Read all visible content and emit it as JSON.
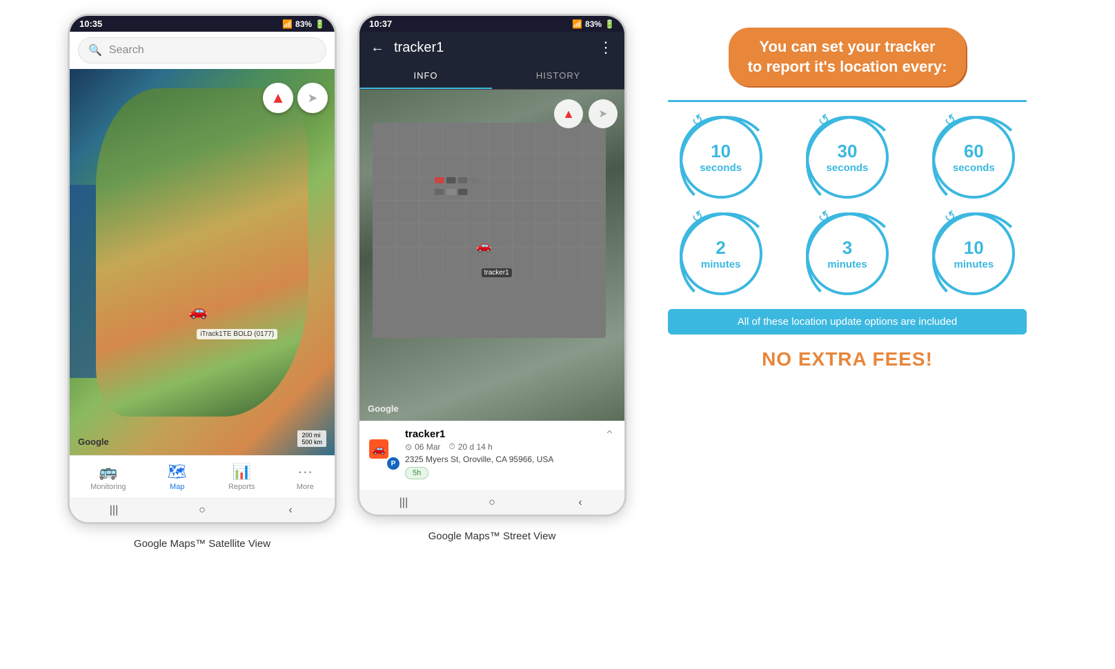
{
  "phone1": {
    "status_time": "10:35",
    "status_signal": "📶",
    "status_battery": "83%",
    "search_placeholder": "Search",
    "compass_icon": "🧭",
    "nav_icon": "➤",
    "car_marker": "🚗",
    "tracker_label": "iTrack1TE BOLD (0177)",
    "scale_text": "200 mi\n500 km",
    "google_logo": "Google",
    "nav_items": [
      {
        "label": "Monitoring",
        "icon": "🚌",
        "active": false
      },
      {
        "label": "Map",
        "icon": "🗺",
        "active": true
      },
      {
        "label": "Reports",
        "icon": "📊",
        "active": false
      },
      {
        "label": "More",
        "icon": "···",
        "active": false
      }
    ],
    "caption": "Google Maps™ Satellite View"
  },
  "phone2": {
    "status_time": "10:37",
    "status_signal": "📶",
    "status_battery": "83%",
    "back_arrow": "←",
    "title": "tracker1",
    "more_icon": "⋮",
    "tabs": [
      {
        "label": "INFO",
        "active": true
      },
      {
        "label": "HISTORY",
        "active": false
      }
    ],
    "google_logo": "Google",
    "car_label": "tracker1",
    "compass_icon": "🧭",
    "nav_icon": "➤",
    "tracker_name": "tracker1",
    "tracker_date": "06 Mar",
    "tracker_duration": "20 d 14 h",
    "tracker_address": "2325 Myers St, Oroville, CA 95966, USA",
    "time_badge": "5h",
    "caption": "Google Maps™ Street View"
  },
  "info_panel": {
    "headline": "You can set your tracker\nto report it's location every:",
    "divider_color": "#3bb8e0",
    "circles": [
      {
        "number": "10",
        "unit": "seconds"
      },
      {
        "number": "30",
        "unit": "seconds"
      },
      {
        "number": "60",
        "unit": "seconds"
      },
      {
        "number": "2",
        "unit": "minutes"
      },
      {
        "number": "3",
        "unit": "minutes"
      },
      {
        "number": "10",
        "unit": "minutes"
      }
    ],
    "no_fee_text": "All of these location update options are included",
    "no_extra_fees": "NO EXTRA FEES!",
    "accent_color": "#e8863a",
    "blue_color": "#3bb8e0"
  }
}
